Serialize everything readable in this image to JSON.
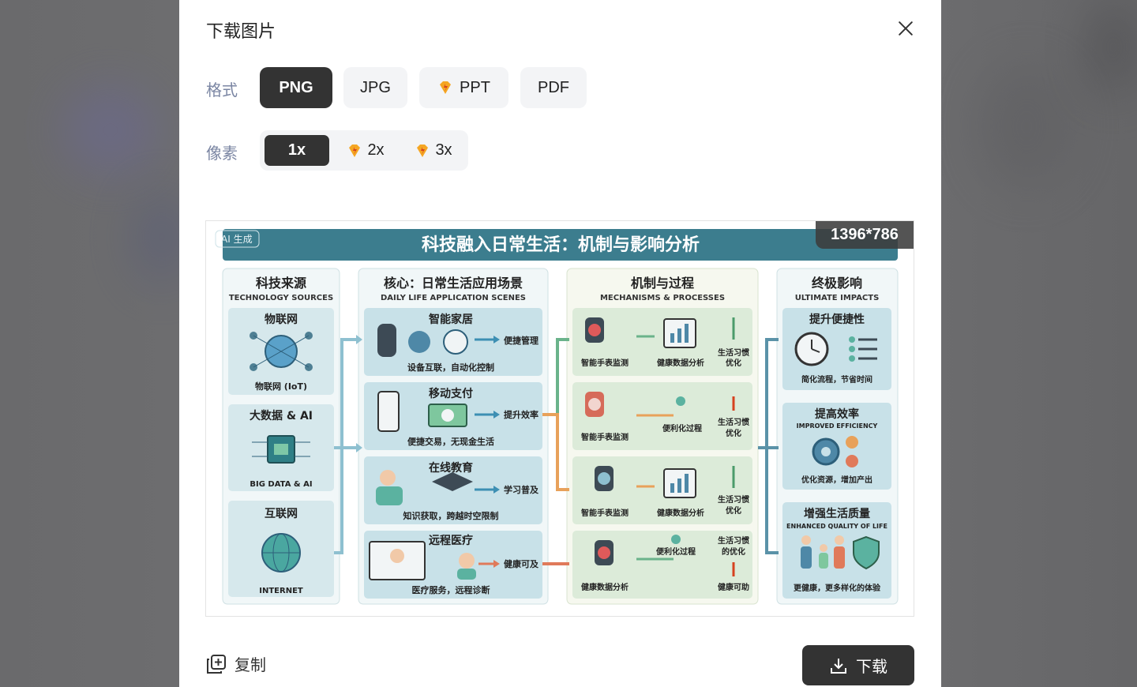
{
  "modal": {
    "title": "下载图片",
    "format_label": "格式",
    "pixel_label": "像素",
    "formats": [
      "PNG",
      "JPG",
      "PPT",
      "PDF"
    ],
    "selected_format": "PNG",
    "scales": [
      "1x",
      "2x",
      "3x"
    ],
    "selected_scale": "1x",
    "dimensions": "1396*786",
    "copy_label": "复制",
    "download_label": "下载"
  },
  "colors": {
    "accent_dark": "#333333",
    "label_gray": "#7b86a3",
    "gem_orange": "#f5a623",
    "banner_teal": "#3c7d8e"
  },
  "infographic": {
    "ai_badge": "AI 生成",
    "title": "科技融入日常生活：机制与影响分析",
    "columns": [
      {
        "title": "科技来源",
        "subtitle": "TECHNOLOGY SOURCES",
        "cards": [
          {
            "title": "物联网",
            "caption": "物联网 (IoT)"
          },
          {
            "title": "大数据 & AI",
            "caption": "BIG DATA & AI"
          },
          {
            "title": "互联网",
            "caption": "INTERNET"
          }
        ]
      },
      {
        "title": "核心：日常生活应用场景",
        "subtitle": "DAILY LIFE APPLICATION SCENES",
        "cards": [
          {
            "title": "智能家居",
            "arrow_text": "便捷管理",
            "caption": "设备互联，自动化控制"
          },
          {
            "title": "移动支付",
            "arrow_text": "提升效率",
            "caption": "便捷交易，无现金生活"
          },
          {
            "title": "在线教育",
            "arrow_text": "学习普及",
            "caption": "知识获取，跨越时空限制"
          },
          {
            "title": "远程医疗",
            "arrow_text": "健康可及",
            "caption": "医疗服务，远程诊断"
          }
        ]
      },
      {
        "title": "机制与过程",
        "subtitle": "MECHANISMS & PROCESSES",
        "rows": [
          {
            "left": "智能手表监测",
            "mid": "健康数据分析",
            "right1": "生活习惯",
            "right2": "优化"
          },
          {
            "left": "智能手表监测",
            "mid": "便利化过程",
            "right1": "生活习惯",
            "right2": "优化"
          },
          {
            "left": "智能手表监测",
            "mid": "健康数据分析",
            "right1": "生活习惯",
            "right2": "优化"
          },
          {
            "left": "健康数据分析",
            "mid": "便利化过程",
            "right1": "生活习惯",
            "right2": "的优化",
            "right3": "健康可助"
          }
        ]
      },
      {
        "title": "终极影响",
        "subtitle": "ULTIMATE IMPACTS",
        "cards": [
          {
            "title": "提升便捷性",
            "subtitle": "",
            "caption": "简化流程，节省时间"
          },
          {
            "title": "提高效率",
            "subtitle": "IMPROVED EFFICIENCY",
            "caption": "优化资源，增加产出"
          },
          {
            "title": "增强生活质量",
            "subtitle": "ENHANCED QUALITY OF LIFE",
            "caption": "更健康，更多样化的体验"
          }
        ]
      }
    ]
  }
}
